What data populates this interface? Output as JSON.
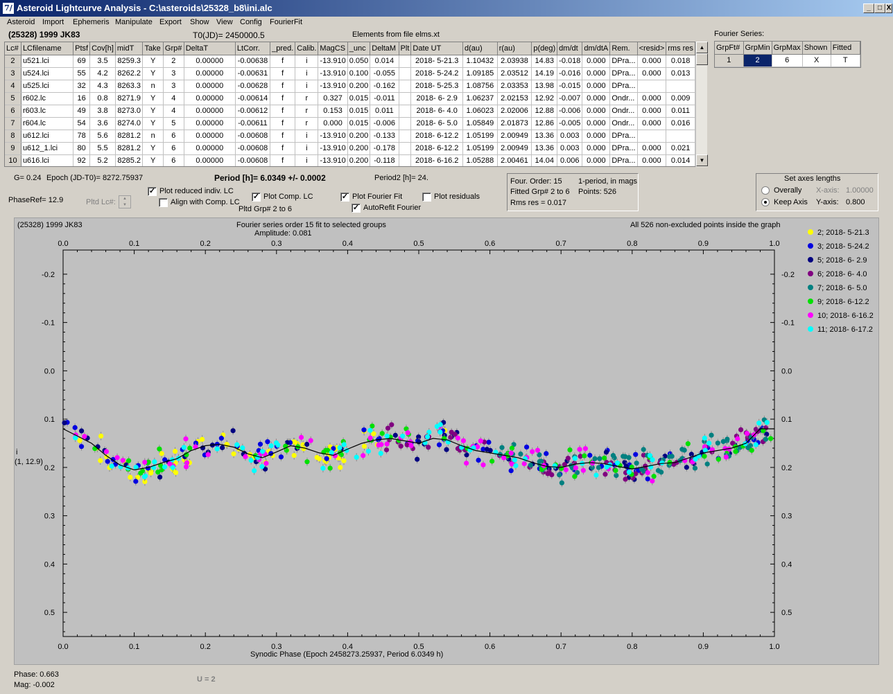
{
  "window": {
    "title": "Asteroid Lightcurve Analysis - C:\\asteroids\\25328_b8\\ini.alc",
    "icon": "7/",
    "buttons": {
      "minimize": "_",
      "maximize": "□",
      "close": "X"
    }
  },
  "menu": [
    "Asteroid",
    "Import",
    "Ephemeris",
    "Manipulate",
    "Export",
    "Show",
    "View",
    "Config",
    "FourierFit"
  ],
  "header": {
    "asteroid": "(25328) 1999 JK83",
    "t0": "T0(JD)= 2450000.5",
    "elements": "Elements from file elms.xt"
  },
  "lc_table": {
    "columns": [
      "Lc#",
      "LCfilename",
      "Ptsf",
      "Cov[h]",
      "midT",
      "Take",
      "Grp#",
      "DeltaT",
      "LtCorr.",
      "_pred.",
      "Calib.",
      "MagCS",
      "_unc",
      "DeltaM",
      "Plt",
      "Date UT",
      "d(au)",
      "r(au)",
      "p(deg)",
      "dm/dt",
      "dm/dtA",
      "Rem.",
      "<resid>",
      "rms res"
    ],
    "rows": [
      [
        "2",
        "u521.lci",
        "69",
        "3.5",
        "8259.3",
        "Y",
        "2",
        "0.00000",
        "-0.00638",
        "f",
        "i",
        "-13.910",
        "0.050",
        "0.014",
        "",
        "2018- 5-21.3",
        "1.10432",
        "2.03938",
        "14.83",
        "-0.018",
        "0.000",
        "DPra...",
        "0.000",
        "0.018"
      ],
      [
        "3",
        "u524.lci",
        "55",
        "4.2",
        "8262.2",
        "Y",
        "3",
        "0.00000",
        "-0.00631",
        "f",
        "i",
        "-13.910",
        "0.100",
        "-0.055",
        "",
        "2018- 5-24.2",
        "1.09185",
        "2.03512",
        "14.19",
        "-0.016",
        "0.000",
        "DPra...",
        "0.000",
        "0.013"
      ],
      [
        "4",
        "u525.lci",
        "32",
        "4.3",
        "8263.3",
        "n",
        "3",
        "0.00000",
        "-0.00628",
        "f",
        "i",
        "-13.910",
        "0.200",
        "-0.162",
        "",
        "2018- 5-25.3",
        "1.08756",
        "2.03353",
        "13.98",
        "-0.015",
        "0.000",
        "DPra...",
        "",
        ""
      ],
      [
        "5",
        "r602.lc",
        "16",
        "0.8",
        "8271.9",
        "Y",
        "4",
        "0.00000",
        "-0.00614",
        "f",
        "r",
        "0.327",
        "0.015",
        "-0.011",
        "",
        "2018- 6- 2.9",
        "1.06237",
        "2.02153",
        "12.92",
        "-0.007",
        "0.000",
        "Ondr...",
        "0.000",
        "0.009"
      ],
      [
        "6",
        "r603.lc",
        "49",
        "3.8",
        "8273.0",
        "Y",
        "4",
        "0.00000",
        "-0.00612",
        "f",
        "r",
        "0.153",
        "0.015",
        "0.011",
        "",
        "2018- 6- 4.0",
        "1.06023",
        "2.02006",
        "12.88",
        "-0.006",
        "0.000",
        "Ondr...",
        "0.000",
        "0.011"
      ],
      [
        "7",
        "r604.lc",
        "54",
        "3.6",
        "8274.0",
        "Y",
        "5",
        "0.00000",
        "-0.00611",
        "f",
        "r",
        "0.000",
        "0.015",
        "-0.006",
        "",
        "2018- 6- 5.0",
        "1.05849",
        "2.01873",
        "12.86",
        "-0.005",
        "0.000",
        "Ondr...",
        "0.000",
        "0.016"
      ],
      [
        "8",
        "u612.lci",
        "78",
        "5.6",
        "8281.2",
        "n",
        "6",
        "0.00000",
        "-0.00608",
        "f",
        "i",
        "-13.910",
        "0.200",
        "-0.133",
        "",
        "2018- 6-12.2",
        "1.05199",
        "2.00949",
        "13.36",
        "0.003",
        "0.000",
        "DPra...",
        "",
        ""
      ],
      [
        "9",
        "u612_1.lci",
        "80",
        "5.5",
        "8281.2",
        "Y",
        "6",
        "0.00000",
        "-0.00608",
        "f",
        "i",
        "-13.910",
        "0.200",
        "-0.178",
        "",
        "2018- 6-12.2",
        "1.05199",
        "2.00949",
        "13.36",
        "0.003",
        "0.000",
        "DPra...",
        "0.000",
        "0.021"
      ],
      [
        "10",
        "u616.lci",
        "92",
        "5.2",
        "8285.2",
        "Y",
        "6",
        "0.00000",
        "-0.00608",
        "f",
        "i",
        "-13.910",
        "0.200",
        "-0.118",
        "",
        "2018- 6-16.2",
        "1.05288",
        "2.00461",
        "14.04",
        "0.006",
        "0.000",
        "DPra...",
        "0.000",
        "0.014"
      ]
    ]
  },
  "fourier_series": {
    "label": "Fourier Series:",
    "columns": [
      "GrpFt#",
      "GrpMin",
      "GrpMax",
      "Shown",
      "Fitted"
    ],
    "row": [
      "1",
      "2",
      "6",
      "X",
      "T"
    ]
  },
  "controls": {
    "g": "G= 0.24",
    "epoch": "Epoch (JD-T0)= 8272.75937",
    "period": "Period [h]= 6.0349 +/- 0.0002",
    "period2": "Period2 [h]= 24.",
    "phaseref": "PhaseRef= 12.9",
    "pltd_lc": "Pltd Lc#:",
    "plot_reduced": "Plot reduced indiv. LC",
    "align_comp": "Align with Comp. LC",
    "plot_comp": "Plot Comp. LC",
    "pltd_grp": "Pltd Grp#  2   to   6",
    "plot_fourier": "Plot Fourier Fit",
    "autorefit": "AutoRefit Fourier",
    "plot_residuals": "Plot residuals",
    "checks": {
      "plot_reduced": true,
      "align_comp": false,
      "plot_comp": true,
      "plot_fourier": true,
      "autorefit": true,
      "plot_residuals": false
    }
  },
  "fit_info": {
    "order": "Four. Order: 15",
    "mode": "1-period, in mags",
    "fitted": "Fitted Grp# 2 to 6",
    "points": "Points: 526",
    "rms": "Rms res     = 0.017"
  },
  "axes_box": {
    "title": "Set axes lengths",
    "overally": "Overally",
    "keep_axis": "Keep Axis",
    "x_axis_label": "X-axis:",
    "x_axis_value": "1.00000",
    "y_axis_label": "Y-axis:",
    "y_axis_value": "0.800",
    "selected": "keep_axis"
  },
  "plot": {
    "object": "(25328) 1999 JK83",
    "title": "Fourier series order 15 fit to selected groups",
    "amplitude": "Amplitude: 0.081",
    "note": "All 526 non-excluded points inside the graph",
    "ylabel_line1": "i",
    "ylabel_line2": "(1, 12.9)",
    "xlabel": "Synodic Phase (Epoch 2458273.25937, Period 6.0349 h)"
  },
  "chart_data": {
    "type": "scatter",
    "xlim": [
      0.0,
      1.0
    ],
    "ylim": [
      -0.25,
      0.55
    ],
    "y_inverted": true,
    "x_ticks": [
      "0.0",
      "0.1",
      "0.2",
      "0.3",
      "0.4",
      "0.5",
      "0.6",
      "0.7",
      "0.8",
      "0.9",
      "1.0"
    ],
    "y_ticks": [
      [
        "-0.2",
        -0.2
      ],
      [
        "-0.1",
        -0.1
      ],
      [
        "0.0",
        0.0
      ],
      [
        "0.1",
        0.1
      ],
      [
        "0.2",
        0.2
      ],
      [
        "0.3",
        0.3
      ],
      [
        "0.4",
        0.4
      ],
      [
        "0.5",
        0.5
      ]
    ],
    "background": "#c0c0c0",
    "fit_curve": {
      "x": [
        0.0,
        0.02,
        0.04,
        0.06,
        0.08,
        0.1,
        0.12,
        0.14,
        0.16,
        0.18,
        0.2,
        0.22,
        0.24,
        0.26,
        0.28,
        0.3,
        0.32,
        0.34,
        0.36,
        0.38,
        0.4,
        0.42,
        0.44,
        0.46,
        0.48,
        0.5,
        0.52,
        0.54,
        0.56,
        0.58,
        0.6,
        0.62,
        0.64,
        0.66,
        0.68,
        0.7,
        0.72,
        0.74,
        0.76,
        0.78,
        0.8,
        0.82,
        0.84,
        0.86,
        0.88,
        0.9,
        0.92,
        0.94,
        0.96,
        0.98,
        1.0
      ],
      "y": [
        0.12,
        0.135,
        0.15,
        0.175,
        0.195,
        0.205,
        0.2,
        0.19,
        0.182,
        0.165,
        0.155,
        0.152,
        0.158,
        0.172,
        0.18,
        0.168,
        0.155,
        0.16,
        0.17,
        0.175,
        0.162,
        0.15,
        0.143,
        0.14,
        0.145,
        0.15,
        0.14,
        0.143,
        0.155,
        0.165,
        0.17,
        0.175,
        0.18,
        0.19,
        0.198,
        0.2,
        0.193,
        0.19,
        0.192,
        0.198,
        0.203,
        0.198,
        0.192,
        0.19,
        0.18,
        0.17,
        0.165,
        0.16,
        0.15,
        0.12,
        0.12
      ]
    },
    "series": [
      {
        "name": "2; 2018- 5-21.3",
        "color": "#ffff00",
        "phase_range": [
          0.0,
          0.55
        ]
      },
      {
        "name": "3; 2018- 5-24.2",
        "color": "#0000e0",
        "phase_range": [
          0.0,
          1.0
        ]
      },
      {
        "name": "5; 2018- 6- 2.9",
        "color": "#000080",
        "phase_range": [
          0.0,
          1.0
        ]
      },
      {
        "name": "6; 2018- 6- 4.0",
        "color": "#800080",
        "phase_range": [
          0.45,
          1.0
        ]
      },
      {
        "name": "7; 2018- 6- 5.0",
        "color": "#008080",
        "phase_range": [
          0.6,
          1.0
        ]
      },
      {
        "name": "9; 2018- 6-12.2",
        "color": "#00e000",
        "phase_range": [
          0.0,
          1.0
        ]
      },
      {
        "name": "10; 2018- 6-16.2",
        "color": "#ff00ff",
        "phase_range": [
          0.0,
          1.0
        ]
      },
      {
        "name": "11; 2018- 6-17.2",
        "color": "#00ffff",
        "phase_range": [
          0.0,
          1.0
        ]
      }
    ],
    "total_points": 526
  },
  "status": {
    "phase": "Phase:  0.663",
    "mag": "Mag:    -0.002",
    "u": "U = 2"
  }
}
